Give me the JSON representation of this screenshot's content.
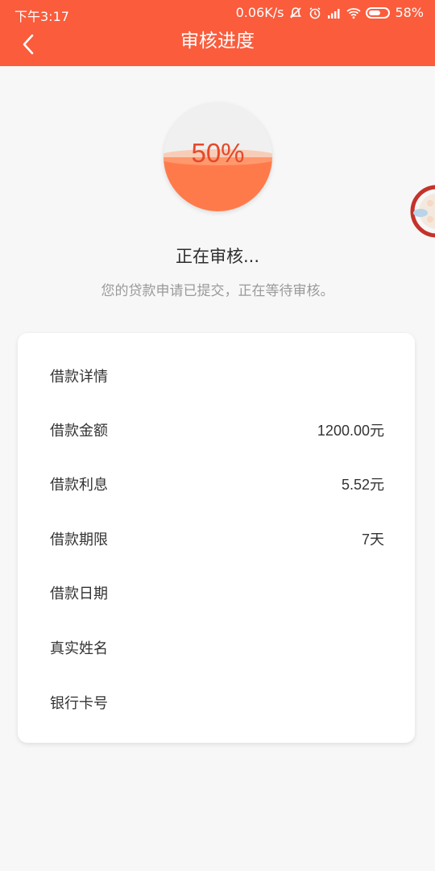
{
  "status_bar": {
    "time": "下午3:17",
    "network_speed": "0.06K/s",
    "battery": "58%"
  },
  "nav": {
    "title": "审核进度",
    "back_icon": "chevron-left-icon"
  },
  "progress": {
    "percent_text": "50%",
    "percent": 50
  },
  "status": {
    "title": "正在审核...",
    "subtitle": "您的贷款申请已提交，正在等待审核。"
  },
  "details": {
    "heading": "借款详情",
    "rows": [
      {
        "label": "借款金额",
        "value": "1200.00元"
      },
      {
        "label": "借款利息",
        "value": "5.52元"
      },
      {
        "label": "借款期限",
        "value": "7天"
      },
      {
        "label": "借款日期",
        "value": ""
      },
      {
        "label": "真实姓名",
        "value": ""
      },
      {
        "label": "银行卡号",
        "value": ""
      }
    ]
  },
  "colors": {
    "header_bg": "#fa5c3c",
    "progress_fill": "#ff7a4b",
    "progress_text": "#e5492a"
  }
}
